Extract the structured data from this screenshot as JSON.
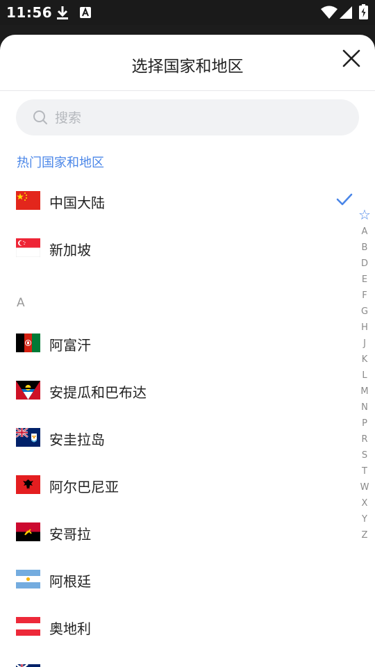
{
  "status_bar": {
    "time": "11:56"
  },
  "header": {
    "title": "选择国家和地区"
  },
  "search": {
    "placeholder": "搜索"
  },
  "sections": {
    "hot_title": "热门国家和地区",
    "a_title": "A"
  },
  "hot_items": [
    {
      "name": "中国大陆",
      "selected": true
    },
    {
      "name": "新加坡",
      "selected": false
    }
  ],
  "a_items": [
    {
      "name": "阿富汗"
    },
    {
      "name": "安提瓜和巴布达"
    },
    {
      "name": "安圭拉岛"
    },
    {
      "name": "阿尔巴尼亚"
    },
    {
      "name": "安哥拉"
    },
    {
      "name": "阿根廷"
    },
    {
      "name": "奥地利"
    }
  ],
  "index_bar": {
    "star": "☆",
    "letters": [
      "A",
      "B",
      "D",
      "E",
      "F",
      "G",
      "H",
      "J",
      "K",
      "L",
      "M",
      "N",
      "P",
      "R",
      "S",
      "T",
      "W",
      "X",
      "Y",
      "Z"
    ]
  },
  "colors": {
    "accent": "#4a86e8"
  }
}
